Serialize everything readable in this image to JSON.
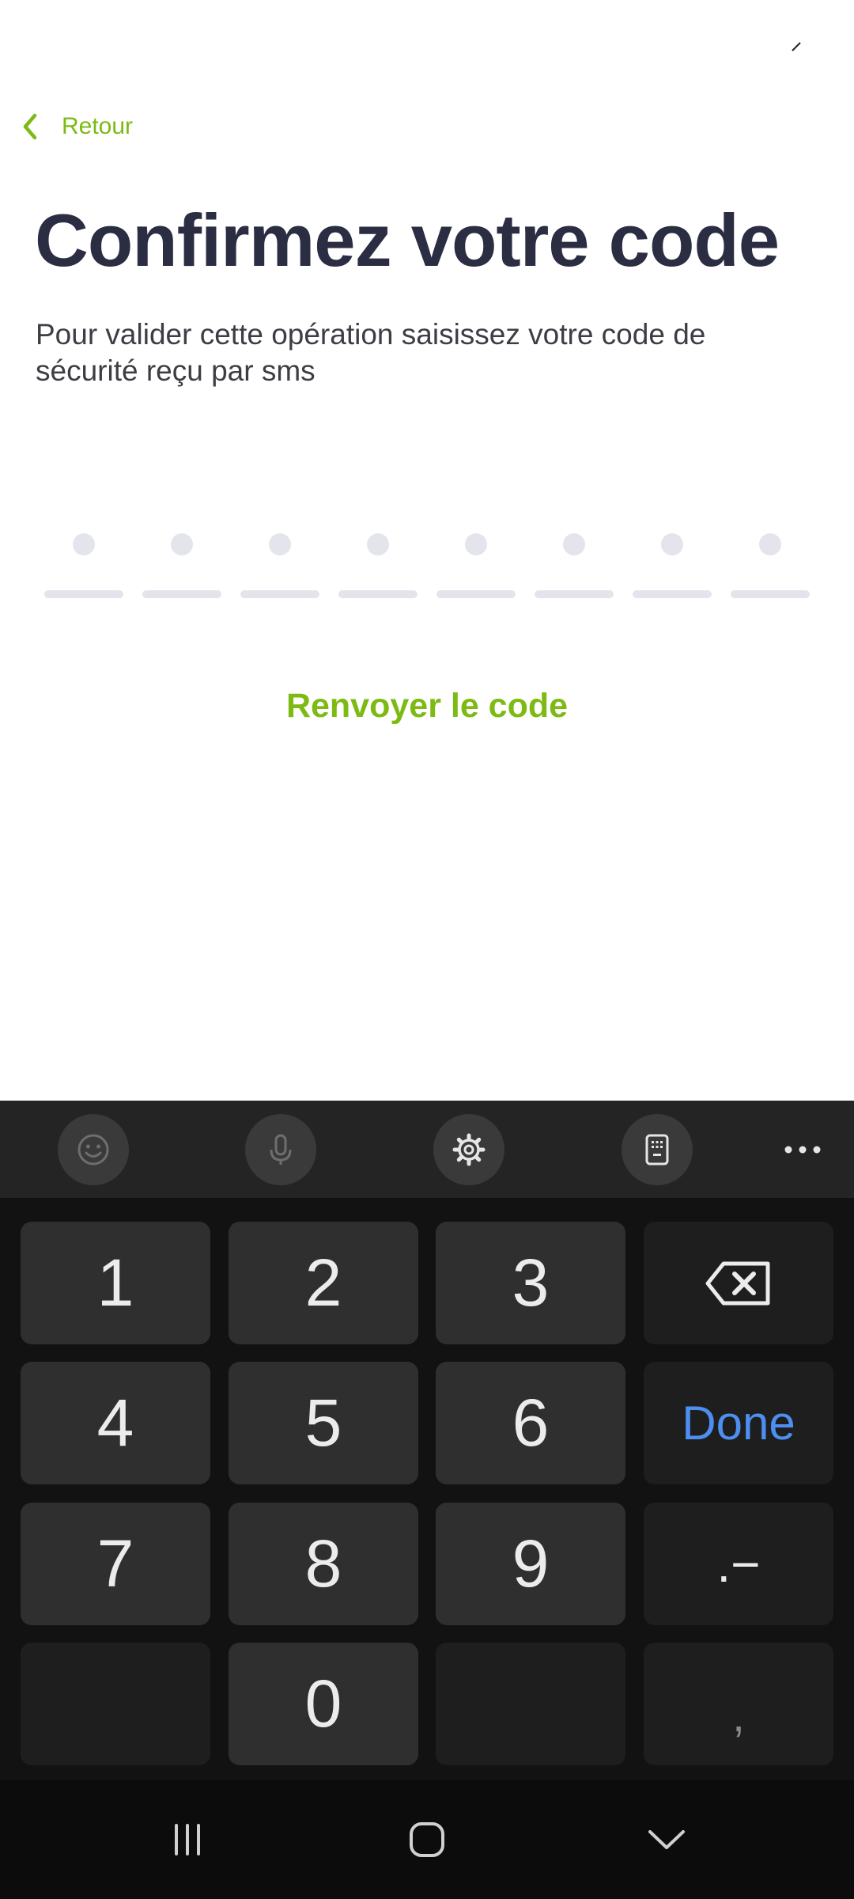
{
  "header": {
    "back_label": "Retour"
  },
  "main": {
    "title": "Confirmez votre code",
    "subtitle": "Pour valider cette opération saisissez votre code de sécurité reçu par sms",
    "code_length": 8,
    "resend_label": "Renvoyer le code"
  },
  "keyboard": {
    "toolbar": [
      "emoji-icon",
      "microphone-icon",
      "gear-icon",
      "keyboard-layout-icon",
      "more-icon"
    ],
    "keys": {
      "k1": "1",
      "k2": "2",
      "k3": "3",
      "k4": "4",
      "k5": "5",
      "k6": "6",
      "k7": "7",
      "k8": "8",
      "k9": "9",
      "k0": "0",
      "done": "Done",
      "symbols": ".−",
      "comma": ","
    }
  },
  "navbar": [
    "recent-apps-icon",
    "home-icon",
    "hide-keyboard-icon"
  ],
  "colors": {
    "accent": "#7dba14",
    "title": "#2b2d42",
    "done_blue": "#4c8ff0",
    "keyboard_bg": "#121212",
    "key_bg": "#2f2f2f"
  }
}
